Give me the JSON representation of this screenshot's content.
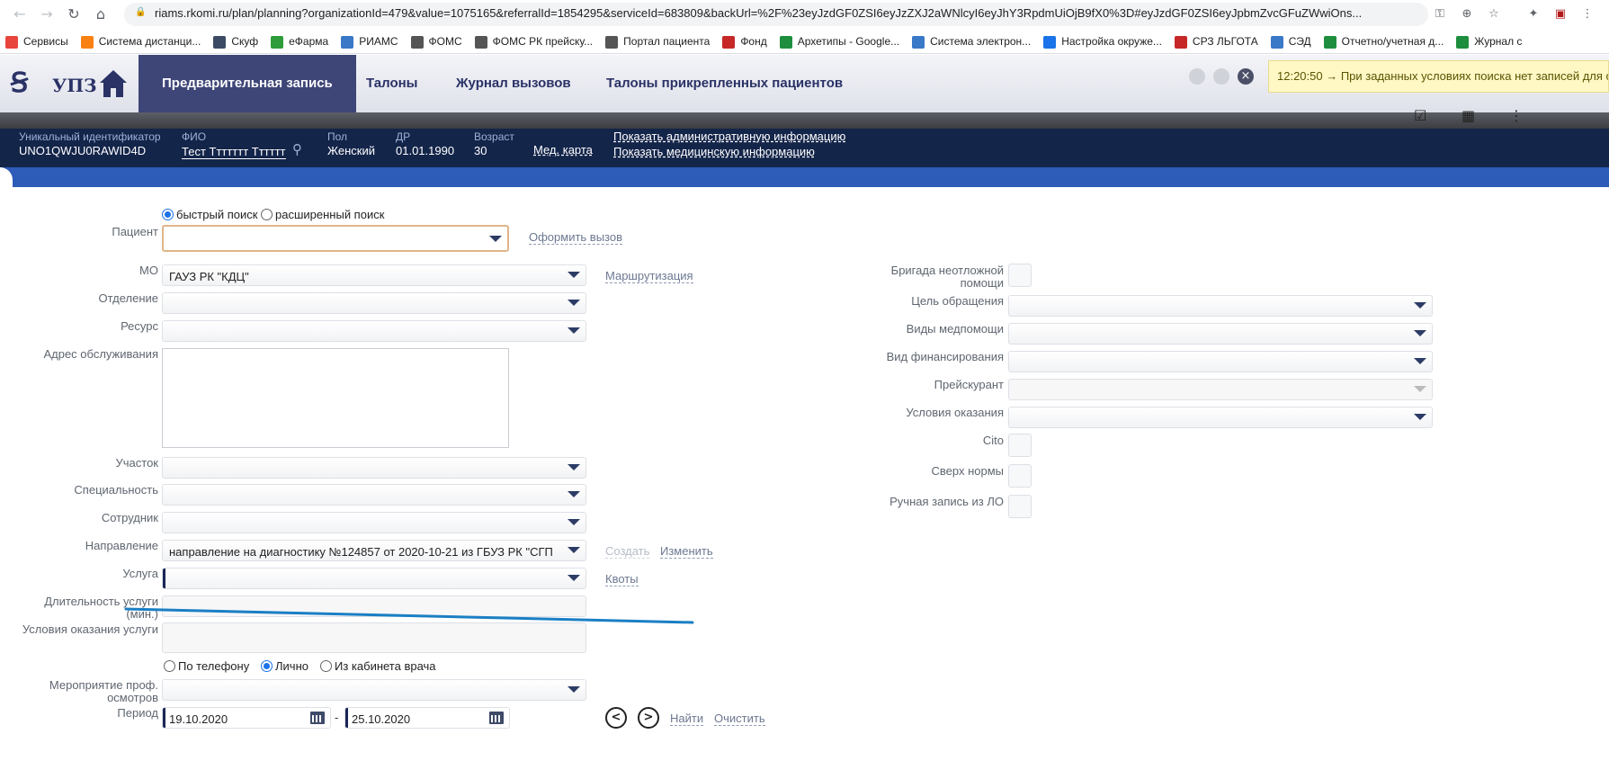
{
  "browser": {
    "url": "riams.rkomi.ru/plan/planning?organizationId=479&value=1075165&referralId=1854295&serviceId=683809&backUrl=%2F%23eyJzdGF0ZSI6eyJzZXJ2aWNlcyI6eyJhY3RpdmUiOjB9fX0%3D#eyJzdGF0ZSI6eyJpbmZvcGFuZWwiOns..."
  },
  "bookmarks": [
    {
      "label": "Сервисы",
      "icon": "apps-grid-icon",
      "color": "#e8453c"
    },
    {
      "label": "Система дистанци...",
      "icon": "moodle-icon",
      "color": "#f98012"
    },
    {
      "label": "Скуф",
      "icon": "play-icon",
      "color": "#3c4b63"
    },
    {
      "label": "еФарма",
      "icon": "efarma-icon",
      "color": "#2e9c3a"
    },
    {
      "label": "РИАМС",
      "icon": "riams-icon",
      "color": "#3a78c8"
    },
    {
      "label": "ФОМС",
      "icon": "globe-icon",
      "color": "#555555"
    },
    {
      "label": "ФОМС РК прейску...",
      "icon": "globe-icon",
      "color": "#555555"
    },
    {
      "label": "Портал пациента",
      "icon": "globe-icon",
      "color": "#555555"
    },
    {
      "label": "Фонд",
      "icon": "cross-icon",
      "color": "#c62828"
    },
    {
      "label": "Архетипы - Google...",
      "icon": "sheets-icon",
      "color": "#1e8e3e"
    },
    {
      "label": "Система электрон...",
      "icon": "sed-icon",
      "color": "#3a78c8"
    },
    {
      "label": "Настройка окруже...",
      "icon": "dropbox-icon",
      "color": "#1a73e8"
    },
    {
      "label": "СРЗ ЛЬГОТА",
      "icon": "srz-icon",
      "color": "#c62828"
    },
    {
      "label": "СЭД",
      "icon": "sed-icon",
      "color": "#3a78c8"
    },
    {
      "label": "Отчетно/учетная д...",
      "icon": "sheets-icon",
      "color": "#1e8e3e"
    },
    {
      "label": "Журнал с",
      "icon": "sheets-icon",
      "color": "#1e8e3e"
    }
  ],
  "app": {
    "logo_text": "УПЗ",
    "tabs": [
      {
        "label": "Предварительная запись",
        "active": true
      },
      {
        "label": "Талоны",
        "active": false
      },
      {
        "label": "Журнал вызовов",
        "active": false
      },
      {
        "label": "Талоны прикрепленных пациентов",
        "active": false
      }
    ],
    "toast": "12:20:50 → При заданных условиях поиска нет записей для о"
  },
  "patient": {
    "uid_label": "Уникальный идентификатор",
    "uid_value": "UNO1QWJU0RAWID4D",
    "fio_label": "ФИО",
    "fio_value": "Тест Ттттттт Тттттт",
    "sex_label": "Пол",
    "sex_value": "Женский",
    "dob_label": "ДР",
    "dob_value": "01.01.1990",
    "age_label": "Возраст",
    "age_value": "30",
    "med_card": "Мед. карта",
    "admin_link": "Показать административную информацию",
    "med_link": "Показать медицинскую информацию"
  },
  "form": {
    "search_fast": "быстрый поиск",
    "search_ext": "расширенный поиск",
    "patient_label": "Пациент",
    "call_link": "Оформить вызов",
    "mo_label": "МО",
    "mo_value": "ГАУЗ РК \"КДЦ\"",
    "route_link": "Маршрутизация",
    "dept_label": "Отделение",
    "resource_label": "Ресурс",
    "address_label": "Адрес обслуживания",
    "area_label": "Участок",
    "specialty_label": "Специальность",
    "employee_label": "Сотрудник",
    "referral_label": "Направление",
    "referral_value": "направление на диагностику №124857 от 2020-10-21 из ГБУЗ РК \"СГП",
    "create_link": "Создать",
    "change_link": "Изменить",
    "service_label": "Услуга",
    "quotas_link": "Квоты",
    "duration_label_1": "Длительность услуги",
    "duration_label_2": "(мин.)",
    "conditions_label": "Условия оказания услуги",
    "by_phone": "По телефону",
    "in_person": "Лично",
    "from_office": "Из кабинета врача",
    "event_label_1": "Мероприятие проф.",
    "event_label_2": "осмотров",
    "period_label": "Период",
    "date_from": "19.10.2020",
    "date_sep": "-",
    "date_to": "25.10.2020",
    "prev_btn": "<",
    "next_btn": ">",
    "find_link": "Найти",
    "clear_link": "Очистить",
    "brigade_label_1": "Бригада неотложной",
    "brigade_label_2": "помощи",
    "purpose_label": "Цель обращения",
    "help_types_label": "Виды медпомощи",
    "funding_label": "Вид финансирования",
    "pricelist_label": "Прейскурант",
    "provision_label": "Условия оказания",
    "cito_label": "Cito",
    "over_norm_label": "Сверх нормы",
    "manual_label": "Ручная запись из ЛО"
  },
  "colors": {
    "accent": "#3e4577",
    "patient_bar": "#14254a",
    "blue_band": "#2d5bb8",
    "annotation_line": "#1a7fc4"
  }
}
